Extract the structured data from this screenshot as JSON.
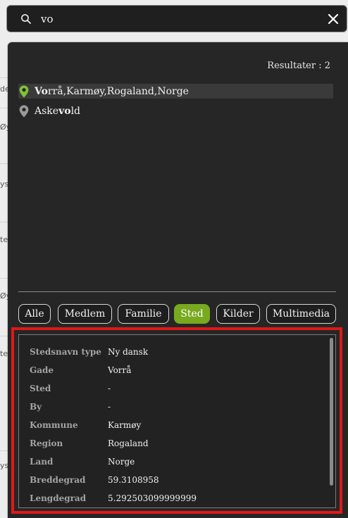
{
  "search": {
    "value": "vo",
    "placeholder": ""
  },
  "results": {
    "count_label": "Resultater : 2",
    "items": [
      {
        "pre": "",
        "match": "Vo",
        "post": "rrå,Karmøy,Rogaland,Norge",
        "pin_color": "#7ec23a"
      },
      {
        "pre": "Aske",
        "match": "vo",
        "post": "ld",
        "pin_color": "#9a9a9a"
      }
    ]
  },
  "filters": {
    "chips": [
      "Alle",
      "Medlem",
      "Familie",
      "Sted",
      "Kilder",
      "Multimedia"
    ],
    "active": "Sted",
    "active_color": "#78a91f"
  },
  "details": {
    "rows": [
      {
        "key": "Stedsnavn type",
        "value": "Ny dansk"
      },
      {
        "key": "Gade",
        "value": "Vorrå"
      },
      {
        "key": "Sted",
        "value": "-"
      },
      {
        "key": "By",
        "value": "-"
      },
      {
        "key": "Kommune",
        "value": "Karmøy"
      },
      {
        "key": "Region",
        "value": "Rogaland"
      },
      {
        "key": "Land",
        "value": "Norge"
      },
      {
        "key": "Breddegrad",
        "value": "59.3108958"
      },
      {
        "key": "Lengdegrad",
        "value": "5.292503099999999"
      }
    ],
    "highlight_color": "#e01818"
  },
  "background_fragments": [
    "de",
    "Øy",
    "ys",
    "te",
    "Øy",
    "te",
    "ys"
  ]
}
